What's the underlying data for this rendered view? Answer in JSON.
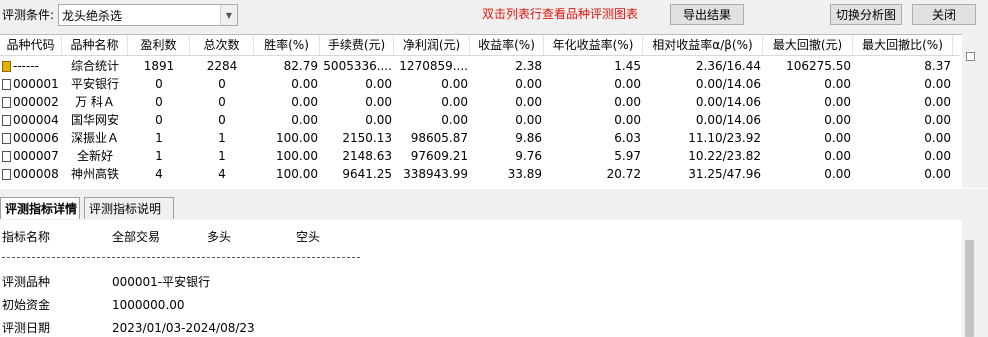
{
  "top_bar": {
    "condition_label": "评测条件:",
    "condition_value": "龙头绝杀选",
    "hint": "双击列表行查看品种评测图表",
    "export_button": "导出结果",
    "switch_button": "切换分析图",
    "close_button": "关闭"
  },
  "table": {
    "columns": [
      "品种代码",
      "品种名称",
      "盈利数",
      "总次数",
      "胜率(%)",
      "手续费(元)",
      "净利润(元)",
      "收益率(%)",
      "年化收益率(%)",
      "相对收益率α/β(%)",
      "最大回撤(元)",
      "最大回撤比(%)"
    ],
    "rows": [
      [
        "------",
        "综合统计",
        "1891",
        "2284",
        "82.79",
        "5005336....",
        "1270859....",
        "2.38",
        "1.45",
        "2.36/16.44",
        "106275.50",
        "8.37"
      ],
      [
        "000001",
        "平安银行",
        "0",
        "0",
        "0.00",
        "0.00",
        "0.00",
        "0.00",
        "0.00",
        "0.00/14.06",
        "0.00",
        "0.00"
      ],
      [
        "000002",
        "万 科Ａ",
        "0",
        "0",
        "0.00",
        "0.00",
        "0.00",
        "0.00",
        "0.00",
        "0.00/14.06",
        "0.00",
        "0.00"
      ],
      [
        "000004",
        "国华网安",
        "0",
        "0",
        "0.00",
        "0.00",
        "0.00",
        "0.00",
        "0.00",
        "0.00/14.06",
        "0.00",
        "0.00"
      ],
      [
        "000006",
        "深振业Ａ",
        "1",
        "1",
        "100.00",
        "2150.13",
        "98605.87",
        "9.86",
        "6.03",
        "11.10/23.92",
        "0.00",
        "0.00"
      ],
      [
        "000007",
        "全新好",
        "1",
        "1",
        "100.00",
        "2148.63",
        "97609.21",
        "9.76",
        "5.97",
        "10.22/23.82",
        "0.00",
        "0.00"
      ],
      [
        "000008",
        "神州高铁",
        "4",
        "4",
        "100.00",
        "9641.25",
        "338943.99",
        "33.89",
        "20.72",
        "31.25/47.96",
        "0.00",
        "0.00"
      ]
    ]
  },
  "tabs": [
    "评测指标详情",
    "评测指标说明"
  ],
  "details": {
    "headers": [
      "指标名称",
      "全部交易",
      "多头",
      "空头"
    ],
    "items": [
      {
        "label": "评测品种",
        "value": "000001-平安银行"
      },
      {
        "label": "初始资金",
        "value": "1000000.00"
      },
      {
        "label": "评测日期",
        "value": "2023/01/03-2024/08/23"
      }
    ]
  },
  "colors": {
    "hint": "#e0140a",
    "summary_icon": "#e6b000"
  },
  "icons": {
    "row_marker": "document-icon",
    "summary_marker": "summary-icon",
    "dropdown": "chevron-down-icon"
  }
}
